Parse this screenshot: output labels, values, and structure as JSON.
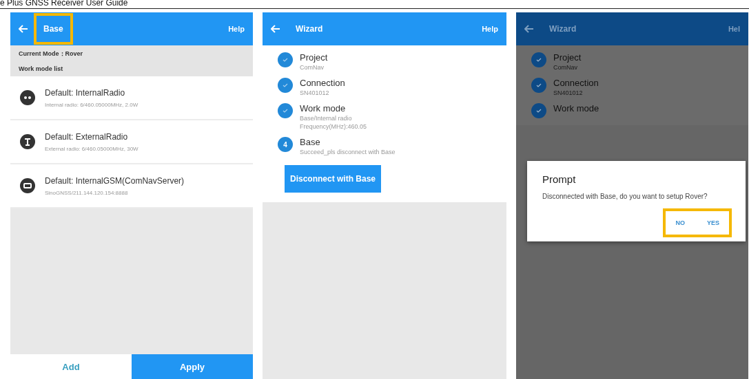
{
  "page_header": "e Plus GNSS Receiver User Guide",
  "screen_1": {
    "title": "Base",
    "title_highlighted": true,
    "help": "Help",
    "current_mode": "Current Mode：Rover",
    "list_heading": "Work mode list",
    "items": [
      {
        "title": "Default: InternalRadio",
        "subtitle": "Internal radio: 6/460.05000MHz, 2.0W",
        "kind": "radio"
      },
      {
        "title": "Default: ExternalRadio",
        "subtitle": "External radio: 6/460.05000MHz, 30W",
        "kind": "antenna"
      },
      {
        "title": "Default: InternalGSM(ComNavServer)",
        "subtitle": "SinoGNSS/211.144.120.154:8888",
        "kind": "gsm"
      }
    ],
    "buttons": [
      {
        "label": "Add",
        "kind": "text"
      },
      {
        "label": "Apply",
        "kind": "primary"
      }
    ]
  },
  "screen_2": {
    "title": "Wizard",
    "help": "Help",
    "steps": [
      {
        "title": "Project",
        "lines": [
          "ComNav"
        ],
        "kind": "done"
      },
      {
        "title": "Connection",
        "lines": [
          "SN401012"
        ],
        "kind": "done"
      },
      {
        "title": "Work mode",
        "lines": [
          "Base/Internal radio",
          "Frequency(MHz):460.05"
        ],
        "kind": "done"
      },
      {
        "title": "Base",
        "number": "4",
        "lines": [
          "Succeed_pls disconnect with Base"
        ],
        "kind": "current"
      }
    ],
    "action": "Disconnect with Base"
  },
  "screen_3": {
    "title": "Wizard",
    "help": "Hel",
    "steps": [
      {
        "title": "Project",
        "lines": [
          "ComNav"
        ],
        "kind": "done"
      },
      {
        "title": "Connection",
        "lines": [
          "SN401012"
        ],
        "kind": "done"
      },
      {
        "title": "Work mode",
        "kind": "done"
      }
    ],
    "dialog": {
      "title": "Prompt",
      "message": "Disconnected with Base, do you want to setup Rover?",
      "buttons_highlighted": true,
      "buttons": [
        "NO",
        "YES"
      ]
    }
  }
}
